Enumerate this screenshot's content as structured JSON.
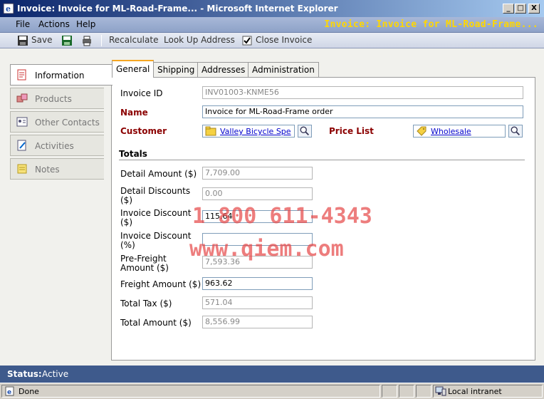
{
  "window": {
    "title": "Invoice: Invoice for ML-Road-Frame... - Microsoft Internet Explorer",
    "minimize": "_",
    "maximize": "□",
    "close": "X"
  },
  "menu": {
    "items": [
      "File",
      "Actions",
      "Help"
    ],
    "page_title": "Invoice: Invoice for ML-Road-Frame..."
  },
  "toolbar": {
    "save": "Save",
    "recalculate": "Recalculate",
    "look_up_address": "Look Up Address",
    "close_invoice": "Close Invoice"
  },
  "nav": {
    "items": [
      "Information",
      "Products",
      "Other Contacts",
      "Activities",
      "Notes"
    ]
  },
  "tabs": [
    "General",
    "Shipping",
    "Addresses",
    "Administration"
  ],
  "form": {
    "invoice_id_label": "Invoice ID",
    "invoice_id": "INV01003-KNME56",
    "name_label": "Name",
    "name": "Invoice for ML-Road-Frame order",
    "customer_label": "Customer",
    "customer": "Valley Bicycle Spe",
    "price_list_label": "Price List",
    "price_list": "Wholesale"
  },
  "totals": {
    "heading": "Totals",
    "detail_amount_label": "Detail Amount ($)",
    "detail_amount": "7,709.00",
    "detail_discounts_label_1": "Detail Discounts",
    "detail_discounts_label_2": "($)",
    "detail_discounts": "0.00",
    "invoice_discount_label_1": "Invoice Discount",
    "invoice_discount_label_2": "($)",
    "invoice_discount": "115.64",
    "invoice_discount_pct_label_1": "Invoice Discount",
    "invoice_discount_pct_label_2": "(%)",
    "invoice_discount_pct": "",
    "pre_freight_label_1": "Pre-Freight",
    "pre_freight_label_2": "Amount ($)",
    "pre_freight": "7,593.36",
    "freight_label": "Freight Amount ($)",
    "freight": "963.62",
    "total_tax_label": "Total Tax ($)",
    "total_tax": "571.04",
    "total_amount_label": "Total Amount ($)",
    "total_amount": "8,556.99"
  },
  "watermark": {
    "phone": "1 800 611-4343",
    "site": "www.qiem.com"
  },
  "crm_status": {
    "label": "Status:",
    "value": "Active"
  },
  "ie_status": {
    "text": "Done",
    "zone": "Local intranet"
  },
  "colors": {
    "title_bar": "#0a246a",
    "crm_title": "#ffd700",
    "required_label": "#8b0000",
    "status_bar": "#3e5a8c"
  }
}
